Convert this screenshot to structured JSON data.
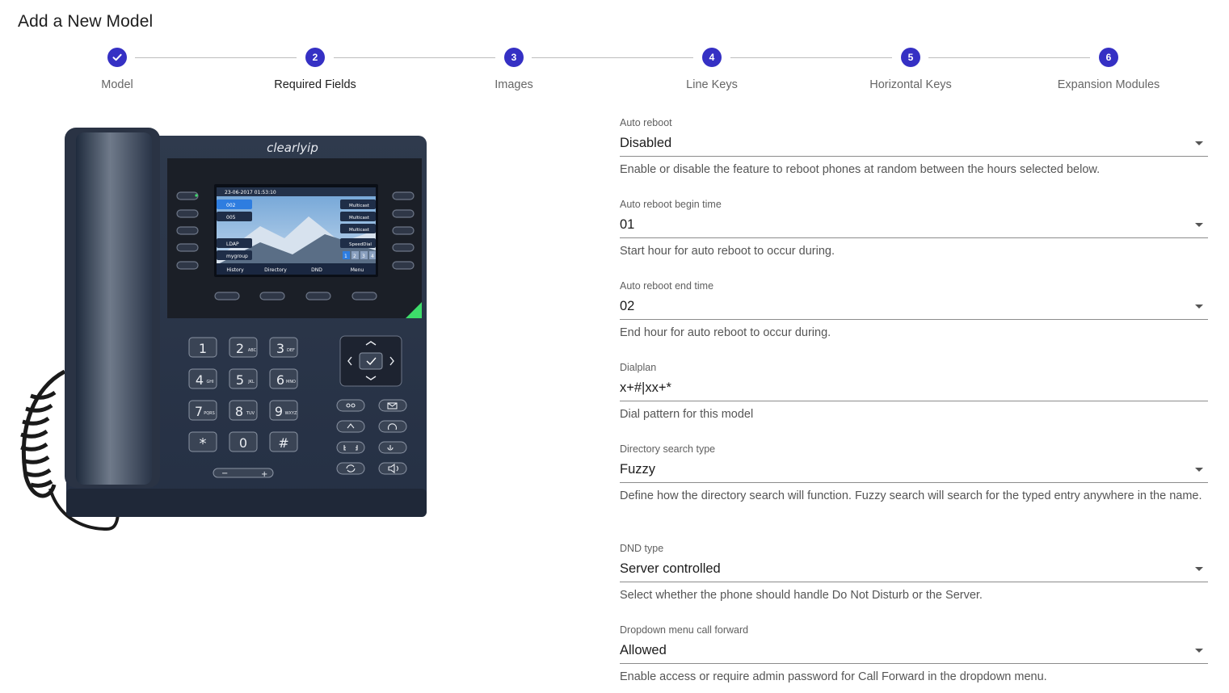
{
  "page": {
    "title": "Add a New Model"
  },
  "stepper": {
    "steps": [
      {
        "number": "1",
        "label": "Model",
        "state": "completed"
      },
      {
        "number": "2",
        "label": "Required Fields",
        "state": "active"
      },
      {
        "number": "3",
        "label": "Images",
        "state": "pending"
      },
      {
        "number": "4",
        "label": "Line Keys",
        "state": "pending"
      },
      {
        "number": "5",
        "label": "Horizontal Keys",
        "state": "pending"
      },
      {
        "number": "6",
        "label": "Expansion Modules",
        "state": "pending"
      }
    ],
    "accent": "#3530c4"
  },
  "phone": {
    "brand": "clearlyip",
    "screen_datetime": "23-06-2017 01:53:10",
    "screen_left_lines": [
      "002",
      "005"
    ],
    "screen_left_bottom": [
      "LDAP",
      "mygroup"
    ],
    "screen_right_lines": [
      "Multicast",
      "Multicast",
      "Multicast",
      "SpeedDial"
    ],
    "screen_pages": [
      "1",
      "2",
      "3",
      "4"
    ],
    "softkeys": [
      "History",
      "Directory",
      "DND",
      "Menu"
    ],
    "keypad": [
      {
        "digit": "1",
        "letters": ""
      },
      {
        "digit": "2",
        "letters": "ABC"
      },
      {
        "digit": "3",
        "letters": "DEF"
      },
      {
        "digit": "4",
        "letters": "GHI"
      },
      {
        "digit": "5",
        "letters": "JKL"
      },
      {
        "digit": "6",
        "letters": "MNO"
      },
      {
        "digit": "7",
        "letters": "PQRS"
      },
      {
        "digit": "8",
        "letters": "TUV"
      },
      {
        "digit": "9",
        "letters": "WXYZ"
      },
      {
        "digit": "*",
        "letters": ""
      },
      {
        "digit": "0",
        "letters": ""
      },
      {
        "digit": "#",
        "letters": ""
      }
    ],
    "volume_minus": "−",
    "volume_plus": "+"
  },
  "form": {
    "auto_reboot": {
      "label": "Auto reboot",
      "value": "Disabled",
      "help": "Enable or disable the feature to reboot phones at random between the hours selected below."
    },
    "auto_reboot_begin": {
      "label": "Auto reboot begin time",
      "value": "01",
      "help": "Start hour for auto reboot to occur during."
    },
    "auto_reboot_end": {
      "label": "Auto reboot end time",
      "value": "02",
      "help": "End hour for auto reboot to occur during."
    },
    "dialplan": {
      "label": "Dialplan",
      "value": "x+#|xx+*",
      "help": "Dial pattern for this model"
    },
    "directory_search_type": {
      "label": "Directory search type",
      "value": "Fuzzy",
      "help": "Define how the directory search will function. Fuzzy search will search for the typed entry anywhere in the name."
    },
    "dnd_type": {
      "label": "DND type",
      "value": "Server controlled",
      "help": "Select whether the phone should handle Do Not Disturb or the Server."
    },
    "dropdown_call_forward": {
      "label": "Dropdown menu call forward",
      "value": "Allowed",
      "help": "Enable access or require admin password for Call Forward in the dropdown menu."
    }
  }
}
